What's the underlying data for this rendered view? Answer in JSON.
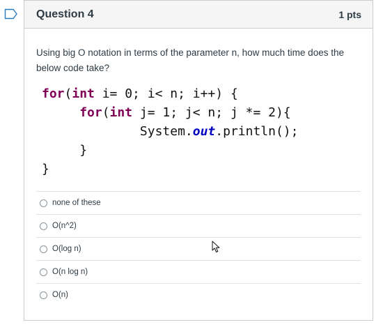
{
  "question": {
    "title": "Question 4",
    "points": "1 pts",
    "prompt": "Using big O notation in terms of the parameter n, how much time does the below code take?"
  },
  "code": {
    "line1": {
      "kw": "for",
      "p1": "(",
      "kw2": "int",
      "rest": " i= 0; i< n; i++) {"
    },
    "line2": {
      "indent": "     ",
      "kw": "for",
      "p1": "(",
      "kw2": "int",
      "rest": " j= 1; j< n; j *= 2){"
    },
    "line3": {
      "indent": "             ",
      "pre": "System.",
      "field": "out",
      "post": ".println();"
    },
    "line4": {
      "indent": "     ",
      "text": "}"
    },
    "line5": {
      "text": "}"
    }
  },
  "answers": [
    {
      "label": "none of these"
    },
    {
      "label": "O(n^2)"
    },
    {
      "label": "O(log n)"
    },
    {
      "label": "O(n log n)"
    },
    {
      "label": "O(n)"
    }
  ],
  "icons": {
    "flag": "bookmark-flag-icon",
    "cursor": "mouse-pointer-icon"
  },
  "colors": {
    "keyword": "#7f0055",
    "field": "#0000c0",
    "flag": "#2b7abc",
    "border": "#c7cdd1"
  }
}
